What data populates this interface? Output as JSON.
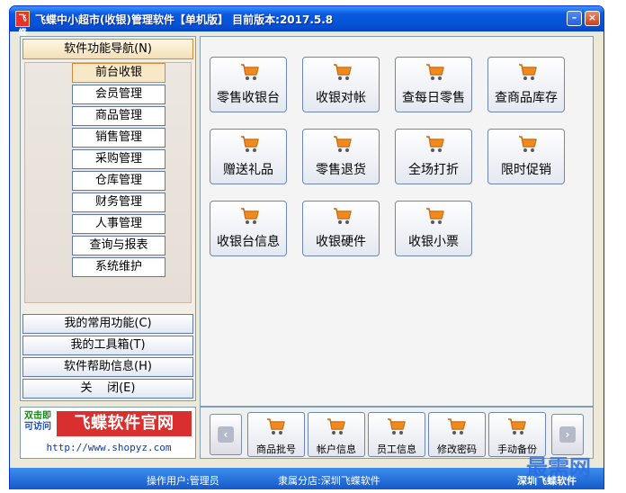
{
  "window": {
    "title": "飞蝶中小超市(收银)管理软件【单机版】 目前版本:2017.5.8",
    "icon_text": "飞蝶",
    "minimize_glyph": "–",
    "close_glyph": "×"
  },
  "nav": {
    "header": "软件功能导航(N)",
    "items": [
      {
        "label": "前台收银",
        "active": true
      },
      {
        "label": "会员管理"
      },
      {
        "label": "商品管理"
      },
      {
        "label": "销售管理"
      },
      {
        "label": "采购管理"
      },
      {
        "label": "仓库管理"
      },
      {
        "label": "财务管理"
      },
      {
        "label": "人事管理"
      },
      {
        "label": "查询与报表"
      },
      {
        "label": "系统维护"
      }
    ],
    "sections": [
      {
        "label": "我的常用功能(C)"
      },
      {
        "label": "我的工具箱(T)"
      },
      {
        "label": "软件帮助信息(H)"
      },
      {
        "label": "关    闭(E)"
      }
    ]
  },
  "logo": {
    "sub_line1": "双击即",
    "sub_line2": "可访问",
    "main": "飞蝶软件官网",
    "url": "http://www.shopyz.com"
  },
  "tiles": [
    {
      "label": "零售收银台"
    },
    {
      "label": "收银对帐"
    },
    {
      "label": "查每日零售"
    },
    {
      "label": "查商品库存"
    },
    {
      "label": "赠送礼品"
    },
    {
      "label": "零售退货"
    },
    {
      "label": "全场打折"
    },
    {
      "label": "限时促销"
    },
    {
      "label": "收银台信息"
    },
    {
      "label": "收银硬件"
    },
    {
      "label": "收银小票"
    }
  ],
  "toolbar": {
    "prev_glyph": "‹",
    "next_glyph": "›",
    "items": [
      {
        "label": "商品批号"
      },
      {
        "label": "帐户信息"
      },
      {
        "label": "员工信息"
      },
      {
        "label": "修改密码"
      },
      {
        "label": "手动备份"
      }
    ]
  },
  "status": {
    "operator": "操作用户:管理员",
    "branch": "隶属分店:深圳飞蝶软件",
    "company": "深圳飞蝶软件"
  },
  "watermark": "最需网",
  "colors": {
    "title_bar": "#0553d6",
    "cart_orange": "#f08a1c",
    "logo_red": "#d92f2f"
  }
}
